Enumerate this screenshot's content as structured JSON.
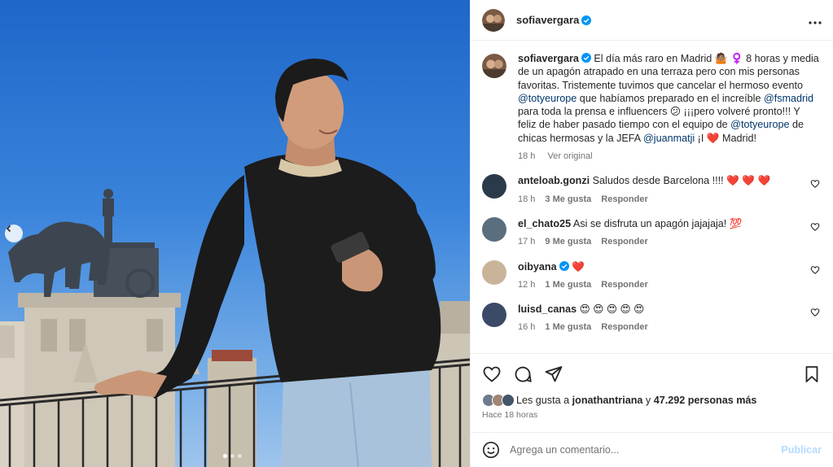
{
  "post": {
    "username": "sofiavergara",
    "caption_parts": [
      {
        "t": "El día más raro en Madrid ",
        "c": "text"
      },
      {
        "t": "🤷🏽",
        "c": "text"
      },
      {
        "t": " ♀️ 8 horas y media de un apagón atrapado en una terraza pero con mis personas favoritas. Tristemente tuvimos que cancelar el hermoso evento ",
        "c": "text"
      },
      {
        "t": "@totyeurope",
        "c": "mention"
      },
      {
        "t": " que habíamos preparado en el increíble ",
        "c": "text"
      },
      {
        "t": "@fsmadrid",
        "c": "mention"
      },
      {
        "t": " para toda la prensa e influencers 😕 ¡¡¡pero volveré pronto!!! Y feliz de haber pasado tiempo con el equipo de ",
        "c": "text"
      },
      {
        "t": "@totyeurope",
        "c": "mention"
      },
      {
        "t": " de chicas hermosas y la JEFA ",
        "c": "text"
      },
      {
        "t": "@juanmatji",
        "c": "mention"
      },
      {
        "t": " ¡I ",
        "c": "text"
      },
      {
        "t": "❤️",
        "c": "text"
      },
      {
        "t": " Madrid!",
        "c": "text"
      }
    ],
    "caption_time": "18 h",
    "see_original": "Ver original"
  },
  "comments": [
    {
      "user": "anteloab.gonzi",
      "verified": false,
      "text": "Saludos desde Barcelona !!!! ❤️ ❤️ ❤️",
      "time": "18 h",
      "likes": "3 Me gusta",
      "reply": "Responder",
      "avatar_color": "#2b3a4a"
    },
    {
      "user": "el_chato25",
      "verified": false,
      "text": "Asi se disfruta un apagón jajajaja! 💯",
      "time": "17 h",
      "likes": "9 Me gusta",
      "reply": "Responder",
      "avatar_color": "#5a6e7e"
    },
    {
      "user": "oibyana",
      "verified": true,
      "text": "❤️",
      "time": "12 h",
      "likes": "1 Me gusta",
      "reply": "Responder",
      "avatar_color": "#c9b49a"
    },
    {
      "user": "luisd_canas",
      "verified": false,
      "text": "😍 😍 😍 😍 😍",
      "time": "16 h",
      "likes": "1 Me gusta",
      "reply": "Responder",
      "avatar_color": "#3b4a66"
    }
  ],
  "likes_summary": {
    "prefix": "Les gusta a ",
    "user": "jonathantriana",
    "middle": " y ",
    "count": "47.292 personas más"
  },
  "posted_ago": "Hace 18 horas",
  "add_comment": {
    "placeholder": "Agrega un comentario...",
    "publish": "Publicar"
  },
  "carousel": {
    "total": 3,
    "active": 1
  },
  "icons": [
    "more-icon",
    "heart-icon",
    "comment-icon",
    "share-icon",
    "bookmark-icon",
    "emoji-icon",
    "chevron-left-icon",
    "verified-icon"
  ],
  "colors": {
    "mention": "#00376b",
    "verified": "#0095f6",
    "muted": "#737373",
    "publish": "#b3dbff",
    "border": "#efefef"
  }
}
